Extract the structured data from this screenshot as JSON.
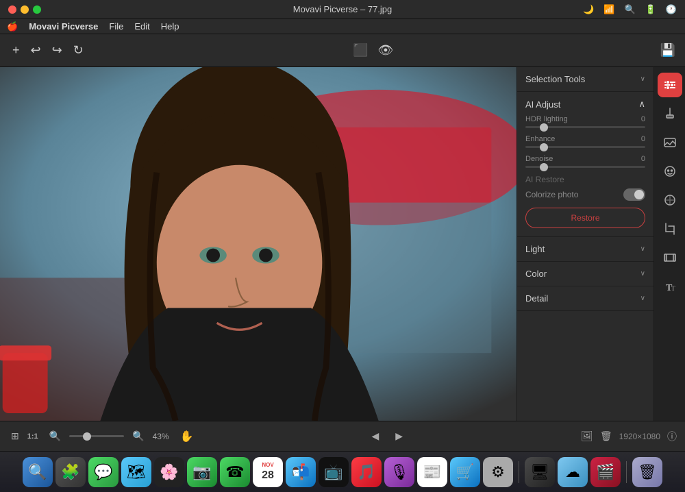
{
  "app": {
    "title": "Movavi Picverse – 77.jpg",
    "name": "Movavi Picverse"
  },
  "menu": {
    "apple": "🍎",
    "items": [
      "Movavi Picverse",
      "File",
      "Edit",
      "Help"
    ]
  },
  "toolbar": {
    "add_label": "+",
    "undo_label": "↩",
    "redo_label": "↪",
    "rotate_label": "↻",
    "compare_label": "⬛",
    "preview_label": "👁"
  },
  "selection_tools": {
    "label": "Selection Tools",
    "expanded": false
  },
  "ai_adjust": {
    "label": "AI Adjust",
    "expanded": true,
    "sliders": [
      {
        "name": "HDR lighting",
        "value": "0",
        "thumb_pct": 12
      },
      {
        "name": "Enhance",
        "value": "0",
        "thumb_pct": 12
      },
      {
        "name": "Denoise",
        "value": "0",
        "thumb_pct": 12
      }
    ],
    "ai_restore": {
      "label": "AI Restore",
      "colorize_label": "Colorize photo",
      "restore_label": "Restore"
    }
  },
  "light_section": {
    "label": "Light"
  },
  "color_section": {
    "label": "Color"
  },
  "detail_section": {
    "label": "Detail"
  },
  "bottom_bar": {
    "fit_label": "⬜",
    "one_one": "1:1",
    "zoom_out": "🔍",
    "zoom_in": "🔍",
    "zoom_pct": "43%",
    "hand_icon": "✋",
    "prev_label": "◀",
    "next_label": "▶",
    "image_label": "🖼",
    "delete_label": "🗑",
    "image_size": "1920×1080",
    "info_label": "ⓘ"
  },
  "dock": {
    "icons": [
      "🔍",
      "🧩",
      "💬",
      "🗺",
      "🖼",
      "📷",
      "☎",
      "📅",
      "📬",
      "📺",
      "🎵",
      "🎙",
      "📰",
      "🛒",
      "⚙",
      "🖥",
      "☁",
      "🎬",
      "🗑"
    ]
  },
  "icon_strip": [
    {
      "name": "sliders-icon",
      "icon": "⚙",
      "active": true
    },
    {
      "name": "stamp-icon",
      "icon": "🔖",
      "active": false
    },
    {
      "name": "image-icon",
      "icon": "🖼",
      "active": false
    },
    {
      "name": "face-icon",
      "icon": "😊",
      "active": false
    },
    {
      "name": "mask-icon",
      "icon": "⊕",
      "active": false
    },
    {
      "name": "crop-icon",
      "icon": "⊞",
      "active": false
    },
    {
      "name": "film-icon",
      "icon": "🎬",
      "active": false
    },
    {
      "name": "text-icon",
      "icon": "T",
      "active": false
    }
  ]
}
